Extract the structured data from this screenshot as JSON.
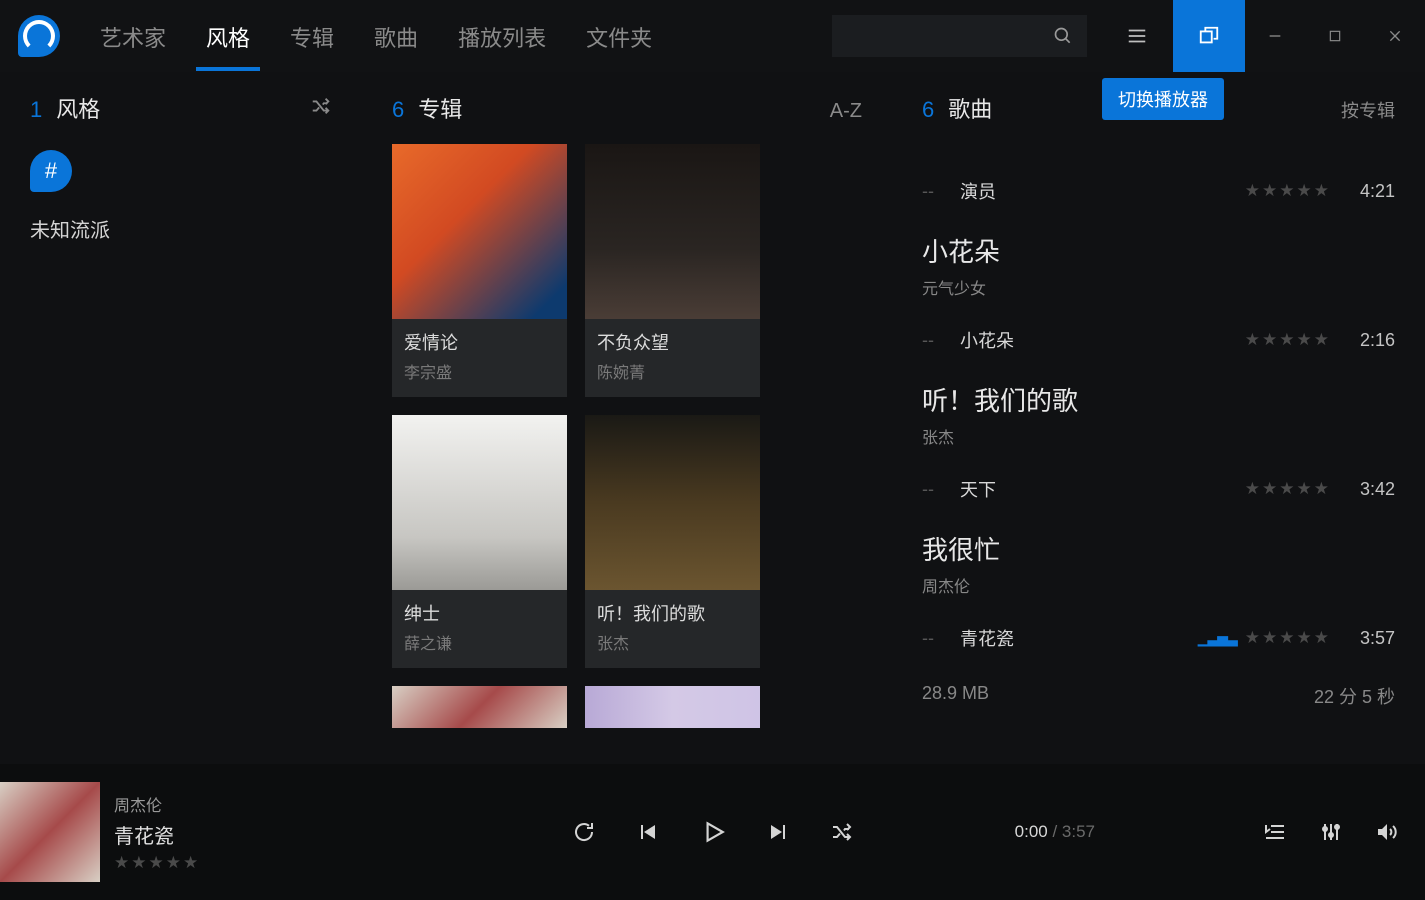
{
  "nav": {
    "tabs": [
      "艺术家",
      "风格",
      "专辑",
      "歌曲",
      "播放列表",
      "文件夹"
    ],
    "active_index": 1
  },
  "tooltip": {
    "switch_player": "切换播放器"
  },
  "left": {
    "count": "1",
    "title": "风格",
    "hash": "#",
    "items": [
      "未知流派"
    ]
  },
  "middle": {
    "count": "6",
    "title": "专辑",
    "sort": "A-Z",
    "albums": [
      {
        "title": "爱情论",
        "artist": "李宗盛"
      },
      {
        "title": "不负众望",
        "artist": "陈婉菁"
      },
      {
        "title": "绅士",
        "artist": "薛之谦"
      },
      {
        "title": "听！我们的歌",
        "artist": "张杰"
      },
      {
        "title": "",
        "artist": ""
      },
      {
        "title": "",
        "artist": ""
      }
    ]
  },
  "right": {
    "count": "6",
    "title": "歌曲",
    "sort": "按专辑",
    "groups": [
      {
        "album": "",
        "artist": "",
        "songs": [
          {
            "track": "--",
            "name": "演员",
            "dur": "4:21",
            "playing": false
          }
        ]
      },
      {
        "album": "小花朵",
        "artist": "元气少女",
        "songs": [
          {
            "track": "--",
            "name": "小花朵",
            "dur": "2:16",
            "playing": false
          }
        ]
      },
      {
        "album": "听！我们的歌",
        "artist": "张杰",
        "songs": [
          {
            "track": "--",
            "name": "天下",
            "dur": "3:42",
            "playing": false
          }
        ]
      },
      {
        "album": "我很忙",
        "artist": "周杰伦",
        "songs": [
          {
            "track": "--",
            "name": "青花瓷",
            "dur": "3:57",
            "playing": true
          }
        ]
      }
    ],
    "footer": {
      "size": "28.9 MB",
      "length": "22 分 5 秒"
    }
  },
  "player": {
    "artist": "周杰伦",
    "title": "青花瓷",
    "current": "0:00",
    "total": "3:57",
    "sep": " / "
  }
}
